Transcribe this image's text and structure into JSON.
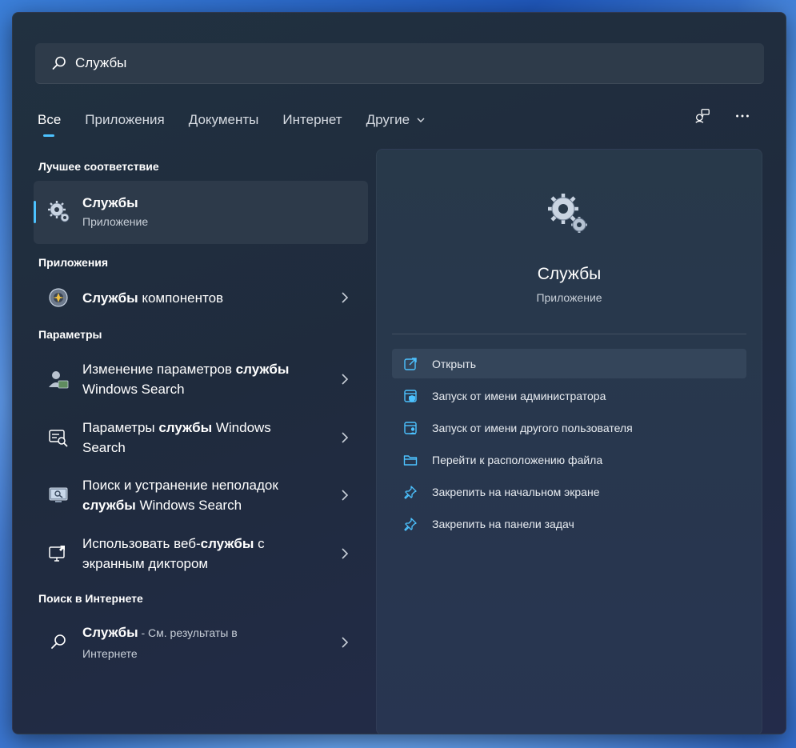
{
  "search": {
    "value": "Службы",
    "placeholder": ""
  },
  "tabs": [
    {
      "label": "Все",
      "active": true
    },
    {
      "label": "Приложения"
    },
    {
      "label": "Документы"
    },
    {
      "label": "Интернет"
    },
    {
      "label": "Другие"
    }
  ],
  "sections": {
    "best": "Лучшее соответствие",
    "apps": "Приложения",
    "settings": "Параметры",
    "web": "Поиск в Интернете"
  },
  "best_match": {
    "name": "Службы",
    "type": "Приложение"
  },
  "apps": [
    {
      "bold": "Службы",
      "rest": " компонентов"
    }
  ],
  "settings": [
    {
      "line1_pre": "Изменение параметров ",
      "line1_bold": "службы",
      "line1_post": "",
      "line2_pre": "Windows Search",
      "line2_bold": "",
      "line2_post": ""
    },
    {
      "line1_pre": "Параметры ",
      "line1_bold": "службы",
      "line1_post": " Windows",
      "line2_pre": "Search",
      "line2_bold": "",
      "line2_post": ""
    },
    {
      "line1_pre": "Поиск и устранение неполадок",
      "line1_bold": "",
      "line1_post": "",
      "line2_pre": "",
      "line2_bold": "службы",
      "line2_post": " Windows Search"
    },
    {
      "line1_pre": "Использовать веб-",
      "line1_bold": "службы",
      "line1_post": " с",
      "line2_pre": "экранным диктором",
      "line2_bold": "",
      "line2_post": ""
    }
  ],
  "web": {
    "bold": "Службы",
    "note1": " - См. результаты в",
    "note2": "Интернете"
  },
  "detail": {
    "title": "Службы",
    "subtitle": "Приложение",
    "actions": [
      {
        "label": "Открыть",
        "icon": "open-icon"
      },
      {
        "label": "Запуск от имени администратора",
        "icon": "admin-shield-icon"
      },
      {
        "label": "Запуск от имени другого пользователя",
        "icon": "other-user-icon"
      },
      {
        "label": "Перейти к расположению файла",
        "icon": "folder-icon"
      },
      {
        "label": "Закрепить на начальном экране",
        "icon": "pin-icon"
      },
      {
        "label": "Закрепить на панели задач",
        "icon": "pin-icon"
      }
    ]
  },
  "colors": {
    "accent": "#4cc2ff",
    "panel": "#1f2b3d",
    "card": "#2d3a4a"
  }
}
